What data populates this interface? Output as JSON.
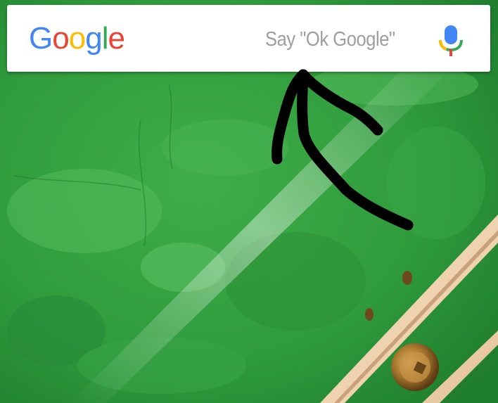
{
  "search_widget": {
    "logo_letters": [
      {
        "char": "G",
        "color": "#4285F4"
      },
      {
        "char": "o",
        "color": "#EA4335"
      },
      {
        "char": "o",
        "color": "#FBBC05"
      },
      {
        "char": "g",
        "color": "#4285F4"
      },
      {
        "char": "l",
        "color": "#34A853"
      },
      {
        "char": "e",
        "color": "#EA4335"
      }
    ],
    "hint_text": "Say \"Ok Google\"",
    "mic_icon": "microphone-icon",
    "mic_colors": [
      "#4285F4",
      "#EA4335",
      "#FBBC05",
      "#34A853"
    ]
  },
  "wallpaper": {
    "base_color": "#2e9a3c",
    "stripe_color": "#e9c8a4",
    "bolt_color": "#a8782f"
  },
  "annotation": {
    "stroke_color": "#000000",
    "shape": "hand-drawn-arrow"
  }
}
